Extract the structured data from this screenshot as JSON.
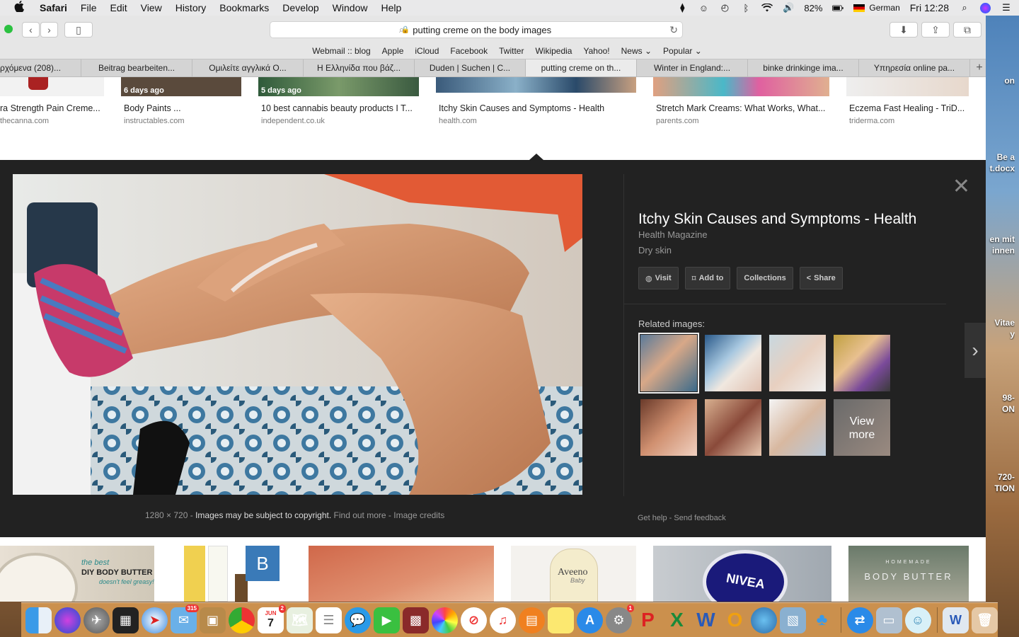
{
  "menubar": {
    "app_name": "Safari",
    "items": [
      "File",
      "Edit",
      "View",
      "History",
      "Bookmarks",
      "Develop",
      "Window",
      "Help"
    ],
    "battery": "82%",
    "input_source": "German",
    "clock": "Fri 12:28"
  },
  "browser": {
    "address": "putting creme on the body images",
    "bookmarks": [
      "Webmail :: blog",
      "Apple",
      "iCloud",
      "Facebook",
      "Twitter",
      "Wikipedia",
      "Yahoo!",
      "News ⌄",
      "Popular ⌄"
    ],
    "tabs": [
      "ρχόμενα (208)...",
      "Beitrag bearbeiten...",
      "Ομιλείτε αγγλικά Ο...",
      "Η Ελληνίδα που βάζ...",
      "Duden | Suchen | C...",
      "putting creme on th...",
      "Winter in England:...",
      "binke drinkinge ima...",
      "Υπηρεσία online pa..."
    ],
    "active_tab_index": 5,
    "new_tab": "+"
  },
  "results_top": [
    {
      "title": "ra Strength Pain Creme...",
      "source": "thecanna.com",
      "badge": ""
    },
    {
      "title": "Body Paints ...",
      "source": "instructables.com",
      "badge": "6 days ago"
    },
    {
      "title": "10 best cannabis beauty products I T...",
      "source": "independent.co.uk",
      "badge": "5 days ago"
    },
    {
      "title": "Itchy Skin Causes and Symptoms - Health",
      "source": "health.com",
      "badge": ""
    },
    {
      "title": "Stretch Mark Creams: What Works, What...",
      "source": "parents.com",
      "badge": ""
    },
    {
      "title": "Eczema Fast Healing - TriD...",
      "source": "triderma.com",
      "badge": ""
    }
  ],
  "panel": {
    "title": "Itchy Skin Causes and Symptoms - Health",
    "site": "Health Magazine",
    "description": "Dry skin",
    "buttons": {
      "visit": "Visit",
      "add_to": "Add to",
      "collections": "Collections",
      "share": "Share"
    },
    "related_label": "Related images:",
    "view_more_1": "View",
    "view_more_2": "more",
    "dimensions": "1280 × 720",
    "sep": "-",
    "copyright": "Images may be subject to copyright.",
    "find_out": "Find out more",
    "credits": "Image credits",
    "help": "Get help",
    "feedback": "Send feedback"
  },
  "results_bottom": [
    {
      "text_1": "the best",
      "text_2": "DIY BODY BUTTER",
      "text_3": "doesn't feel greasy!"
    },
    {
      "text_1": "B"
    },
    {
      "text_1": ""
    },
    {
      "text_1": "Aveeno",
      "text_2": "Baby"
    },
    {
      "text_1": "NIVEA"
    },
    {
      "text_1": "HOMEMADE",
      "text_2": "BODY BUTTER"
    }
  ],
  "desktop_labels": [
    "on",
    "Be a",
    "t.docx",
    "en mit",
    "innen",
    "Vitae",
    "y",
    "98-",
    "ON",
    "720-",
    "TION"
  ],
  "dock": {
    "badges": {
      "photos": "315",
      "calendar": "2",
      "prefs": "1"
    },
    "calendar_month": "JUN",
    "calendar_day": "7"
  }
}
